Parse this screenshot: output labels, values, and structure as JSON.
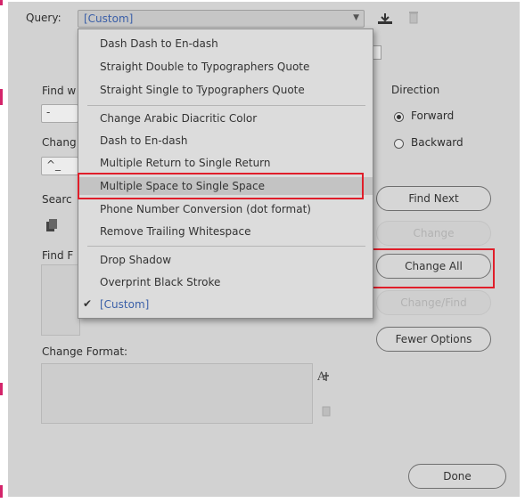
{
  "query": {
    "label": "Query:",
    "value": "[Custom]"
  },
  "menu": {
    "items": [
      "Dash Dash to En-dash",
      "Straight Double to Typographers Quote",
      "Straight Single to Typographers Quote",
      "Change Arabic Diacritic Color",
      "Dash to En-dash",
      "Multiple Return to Single Return",
      "Multiple Space to Single Space",
      "Phone Number Conversion (dot format)",
      "Remove Trailing Whitespace",
      "Drop Shadow",
      "Overprint Black Stroke",
      "[Custom]"
    ],
    "highlighted": "Multiple Space to Single Space",
    "selected": "[Custom]"
  },
  "find_what": {
    "label": "Find w",
    "value": "-"
  },
  "change_to": {
    "label": "Chang",
    "value": "^_"
  },
  "search": {
    "label": "Searc"
  },
  "find_format": {
    "label": "Find F"
  },
  "change_format": {
    "label": "Change Format:"
  },
  "direction": {
    "label": "Direction",
    "forward": "Forward",
    "backward": "Backward",
    "selected": "Forward"
  },
  "buttons": {
    "find_next": "Find Next",
    "change": "Change",
    "change_all": "Change All",
    "change_find": "Change/Find",
    "fewer_options": "Fewer Options",
    "done": "Done"
  },
  "colors": {
    "highlight_box": "#e01e2a",
    "selected_text": "#3a5fa8"
  }
}
